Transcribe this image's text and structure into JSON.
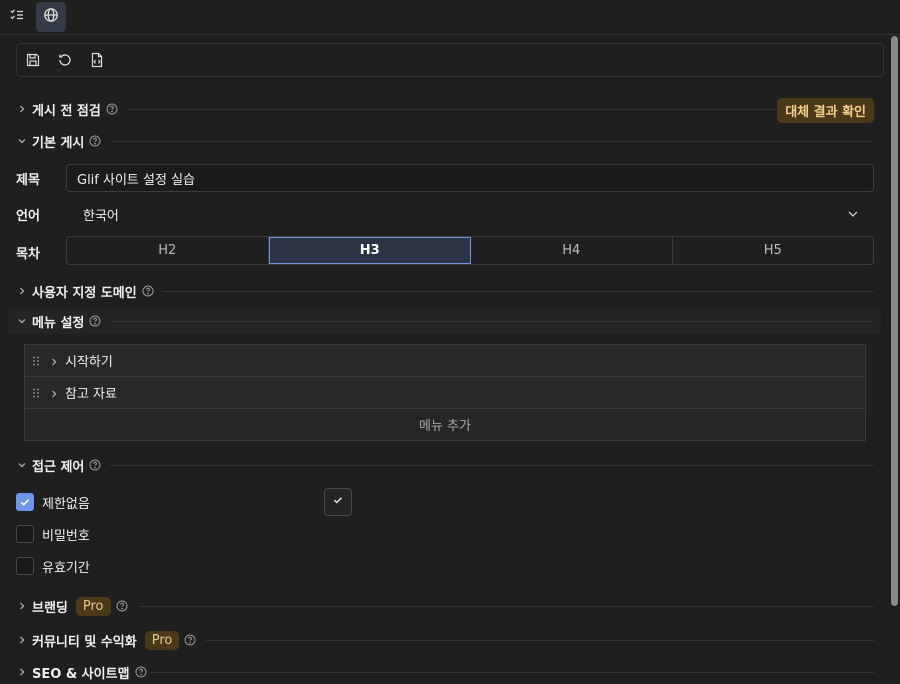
{
  "topbar": {
    "tabs": [
      {
        "icon": "checklist-icon",
        "active": false
      },
      {
        "icon": "globe-icon",
        "active": true
      }
    ]
  },
  "toolbar": {
    "icons": [
      "save-icon",
      "reset-icon",
      "code-file-icon"
    ]
  },
  "sections": {
    "prepublish": {
      "title": "게시 전 점검",
      "badge": "대체 결과 확인",
      "expanded": false
    },
    "basic": {
      "title": "기본 게시",
      "expanded": true
    },
    "custom_domain": {
      "title": "사용자 지정 도메인",
      "expanded": false
    },
    "menu": {
      "title": "메뉴 설정",
      "expanded": true
    },
    "access": {
      "title": "접근 제어",
      "expanded": true
    },
    "branding": {
      "title": "브랜딩",
      "badge": "Pro",
      "expanded": false
    },
    "community": {
      "title": "커뮤니티 및 수익화",
      "badge": "Pro",
      "expanded": false
    },
    "seo": {
      "title": "SEO & 사이트맵",
      "expanded": false
    }
  },
  "basic_form": {
    "title_label": "제목",
    "title_value": "Glif 사이트 설정 실습",
    "language_label": "언어",
    "language_value": "한국어",
    "toc_label": "목차",
    "toc_options": [
      "H2",
      "H3",
      "H4",
      "H5"
    ],
    "toc_selected": "H3"
  },
  "menu_settings": {
    "items": [
      {
        "label": "시작하기"
      },
      {
        "label": "참고 자료"
      }
    ],
    "add_label": "메뉴 추가"
  },
  "access_control": {
    "options": [
      {
        "label": "제한없음",
        "checked": true
      },
      {
        "label": "비밀번호",
        "checked": false
      },
      {
        "label": "유효기간",
        "checked": false
      }
    ]
  },
  "colors": {
    "accent": "#6e95e8",
    "badge_bg": "#4a3a1a",
    "badge_text": "#f2cf8a",
    "background": "#1f1f1f"
  }
}
